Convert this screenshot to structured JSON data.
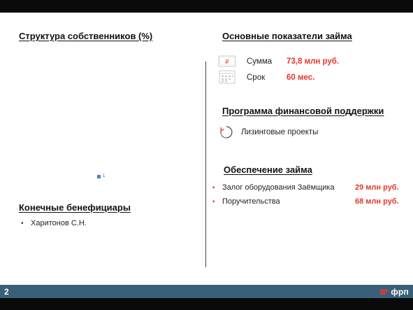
{
  "ownership": {
    "title": "Структура собственников (%)",
    "legend": [
      {
        "label": "1",
        "color": "#4f81bd"
      }
    ]
  },
  "beneficiaries": {
    "title": "Конечные бенефициары",
    "items": [
      "Харитонов С.Н."
    ]
  },
  "loan_indicators": {
    "title": "Основные показатели займа",
    "rows": [
      {
        "label": "Сумма",
        "value": "73,8 млн руб.",
        "icon": "ruble-banknote-icon"
      },
      {
        "label": "Срок",
        "value": "60 мес.",
        "icon": "calendar-icon"
      }
    ]
  },
  "support_program": {
    "title": "Программа финансовой поддержки",
    "item": "Лизинговые проекты",
    "icon": "cycle-arrows-icon"
  },
  "collateral": {
    "title": "Обеспечение займа",
    "items": [
      {
        "label": "Залог оборудования Заёмщика",
        "amount": "29 млн руб."
      },
      {
        "label": "Поручительства",
        "amount": "68 млн руб."
      }
    ]
  },
  "footer": {
    "page_number": "2",
    "logo_text": "фрп"
  },
  "colors": {
    "accent": "#e8352b",
    "footer": "#3a5f78",
    "bars": "#0a0a0a"
  }
}
